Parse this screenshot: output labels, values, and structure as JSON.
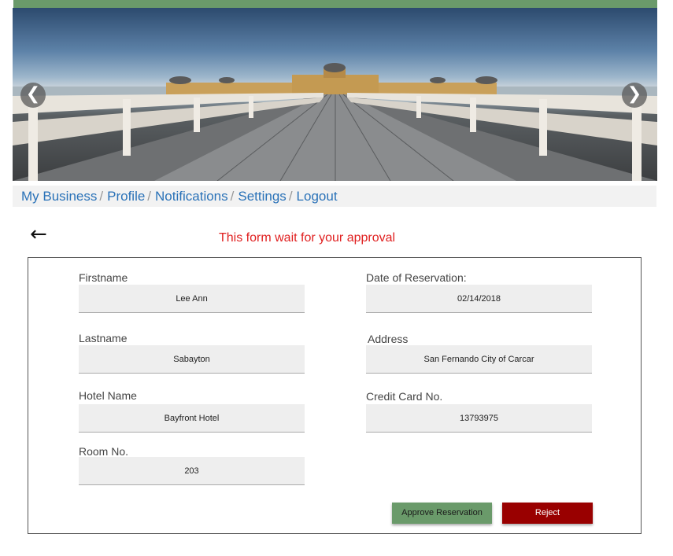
{
  "nav": {
    "items": [
      {
        "label": "My Business",
        "sep": "/"
      },
      {
        "label": "Profile",
        "sep": "/"
      },
      {
        "label": "Notifications",
        "sep": "/"
      },
      {
        "label": "Settings",
        "sep": "/"
      },
      {
        "label": "Logout",
        "sep": ""
      }
    ]
  },
  "carousel": {
    "prev": "❮",
    "next": "❯"
  },
  "back": "←",
  "notice": "This form wait for your approval",
  "form": {
    "firstname": {
      "label": "Firstname",
      "value": "Lee Ann"
    },
    "lastname": {
      "label": "Lastname",
      "value": "Sabayton"
    },
    "hotel": {
      "label": "Hotel Name",
      "value": "Bayfront Hotel"
    },
    "room": {
      "label": "Room No.",
      "value": "203"
    },
    "date": {
      "label": "Date of Reservation:",
      "value": "02/14/2018"
    },
    "address": {
      "label": "Address",
      "value": "San Fernando City of Carcar"
    },
    "card": {
      "label": "Credit Card No.",
      "value": "13793975"
    }
  },
  "actions": {
    "approve": "Approve Reservation",
    "reject": "Reject"
  },
  "colors": {
    "accent_green": "#6a9a6a",
    "reject_red": "#990000",
    "notice_red": "#e02020",
    "link_blue": "#2a72b8"
  }
}
